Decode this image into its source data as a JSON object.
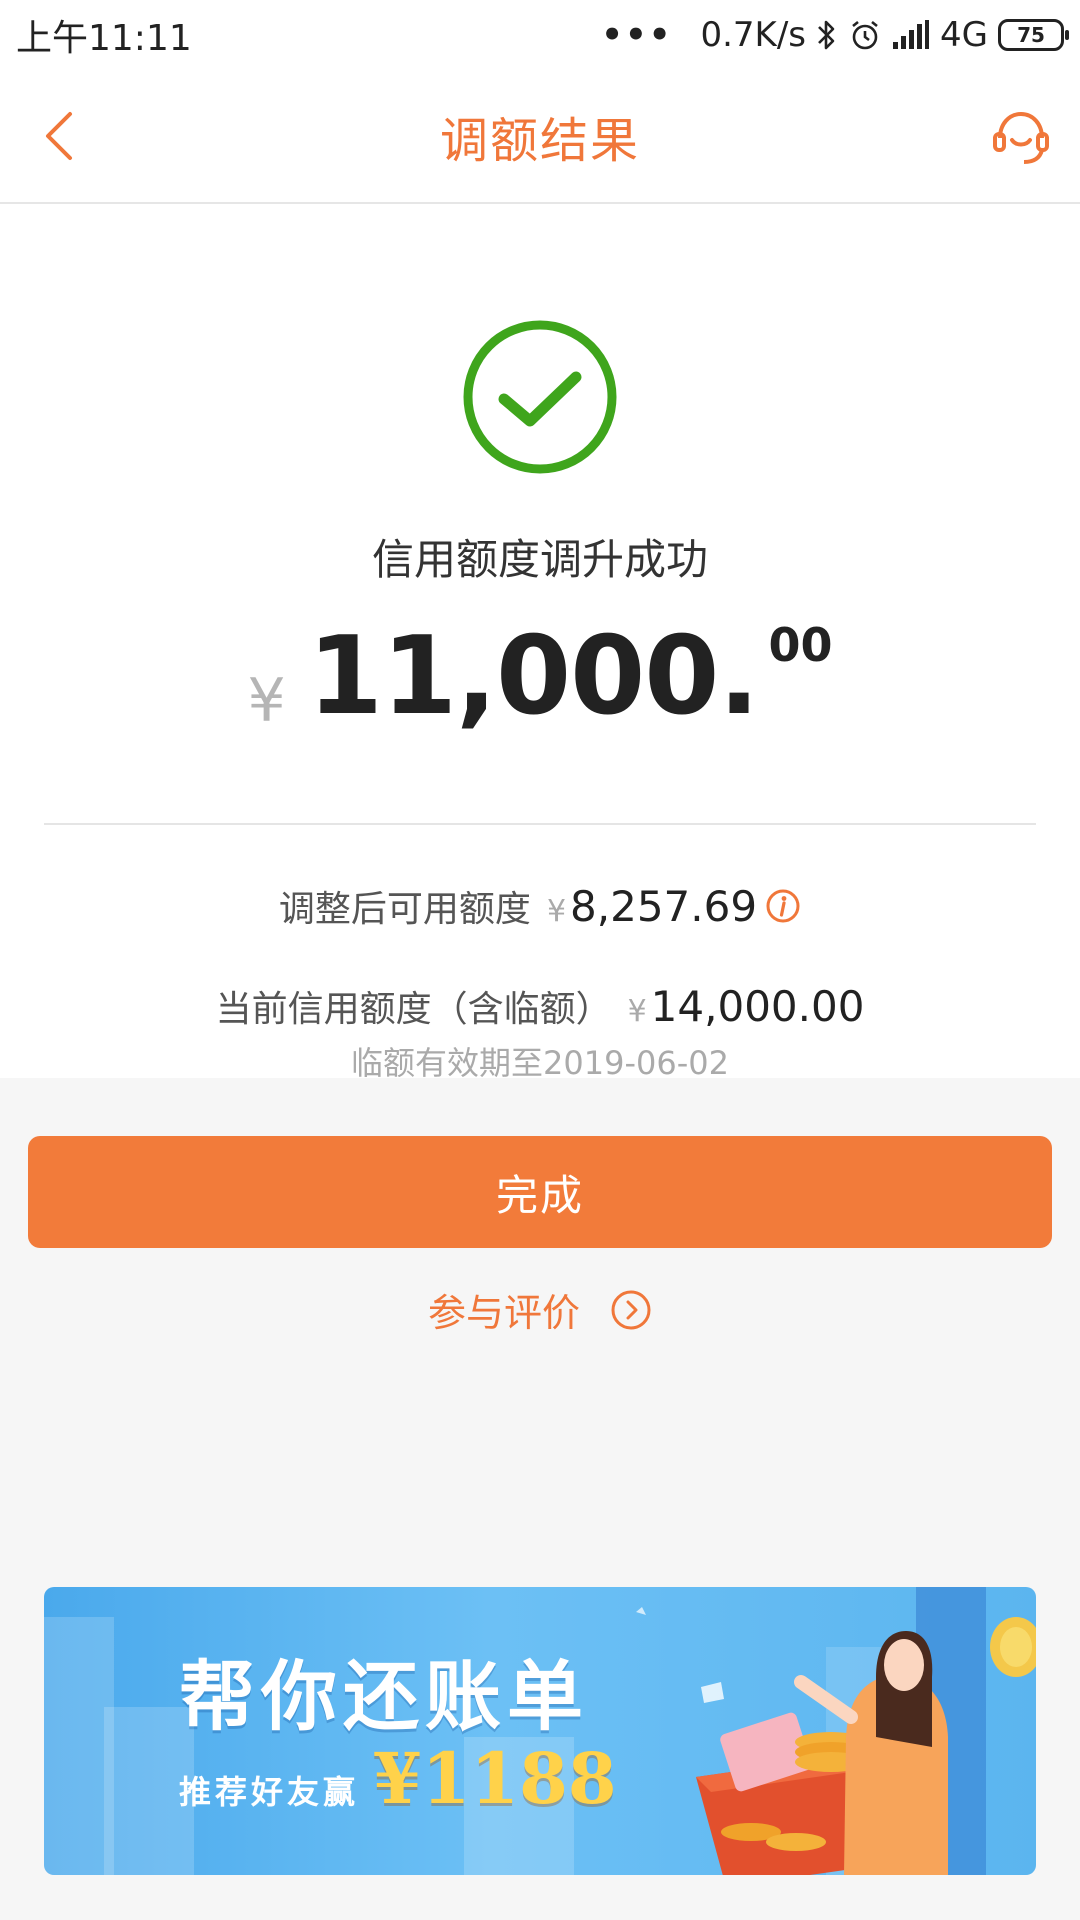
{
  "status_bar": {
    "time": "上午11:11",
    "network_speed": "0.7K/s",
    "network_type": "4G",
    "battery": "75"
  },
  "nav": {
    "title": "调额结果",
    "accent_color": "#f0773a"
  },
  "result": {
    "message": "信用额度调升成功",
    "currency": "¥",
    "amount_integer": "11,000.",
    "amount_decimal": "00",
    "status_color": "#3fa51c"
  },
  "details": {
    "available_label": "调整后可用额度",
    "available_currency": "¥",
    "available_value": "8,257.69",
    "current_label": "当前信用额度（含临额）",
    "current_currency": "¥",
    "current_value": "14,000.00",
    "temp_note": "临额有效期至2019-06-02"
  },
  "actions": {
    "done_label": "完成",
    "feedback_label": "参与评价",
    "button_color": "#f27b3a"
  },
  "banner": {
    "title": "帮你还账单",
    "subtitle": "推荐好友赢",
    "amount": "¥1188"
  }
}
